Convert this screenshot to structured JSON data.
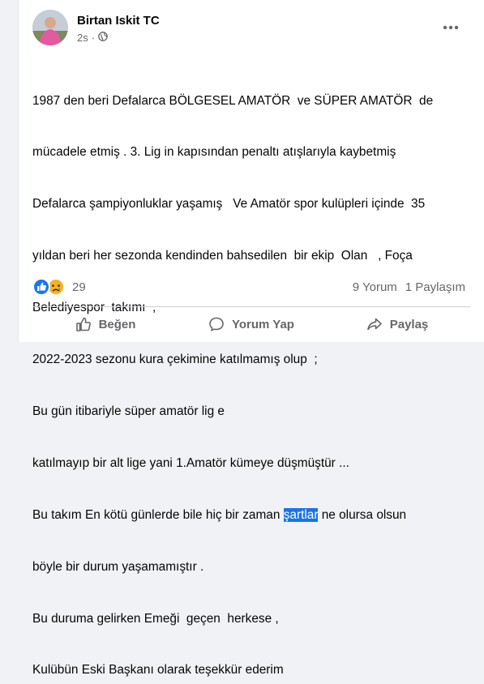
{
  "post": {
    "author": "Birtan Iskit TC",
    "time": "2s",
    "privacy_icon": "globe-icon",
    "more_icon": "more-horizontal-icon",
    "lines": [
      {
        "text": "1987 den beri Defalarca BÖLGESEL AMATÖR  ve SÜPER AMATÖR  de"
      },
      {
        "text": "mücadele etmiş . 3. Lig in kapısından penaltı atışlarıyla kaybetmiş"
      },
      {
        "text": "Defalarca şampiyonluklar yaşamış   Ve Amatör spor kulüpleri içinde  35"
      },
      {
        "text": "yıldan beri her sezonda kendinden bahsedilen  bir ekip  Olan   , Foça"
      },
      {
        "text": "Belediyespor  takımı  ,"
      },
      {
        "text": "2022-2023 sezonu kura çekimine katılmamış olup  ;"
      },
      {
        "text": "Bu gün itibariyle süper amatör lig e"
      },
      {
        "text": "katılmayıp bir alt lige yani 1.Amatör kümeye düşmüştür ..."
      },
      {
        "before": "Bu takım En kötü günlerde bile hiç bir zaman ",
        "selected": "şartlar",
        "after": " ne olursa olsun"
      },
      {
        "text": "böyle bir durum yaşamamıştır ."
      },
      {
        "text": "Bu duruma gelirken Emeği  geçen  herkese ,"
      },
      {
        "text": "Kulübün Eski Başkanı olarak teşekkür ederim"
      }
    ]
  },
  "reactions": {
    "icons": [
      "like-reaction-icon",
      "sad-reaction-icon"
    ],
    "count": "29",
    "comments": "9 Yorum",
    "shares": "1 Paylaşım"
  },
  "actions": [
    {
      "label": "Beğen",
      "icon": "thumbs-up-icon"
    },
    {
      "label": "Yorum Yap",
      "icon": "comment-icon"
    },
    {
      "label": "Paylaş",
      "icon": "share-icon"
    }
  ],
  "colors": {
    "like_blue": "#1877f2",
    "sad_yellow": "#f7b125",
    "selection": "#1a73e8",
    "muted": "#65676b"
  }
}
